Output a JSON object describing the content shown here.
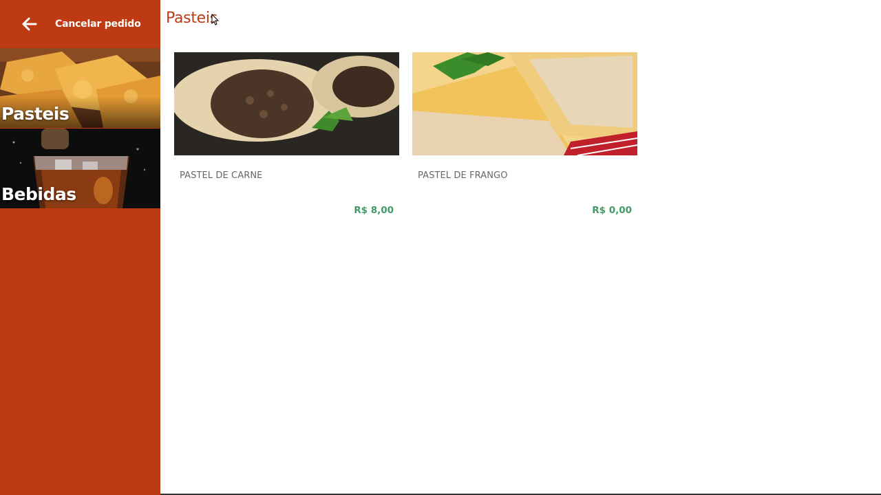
{
  "header": {
    "back_icon": "arrow-left-icon",
    "cancel_label": "Cancelar pedido"
  },
  "sidebar": {
    "categories": [
      {
        "label": "Pasteis",
        "image": "pastel-photo"
      },
      {
        "label": "Bebidas",
        "image": "soda-glass-photo"
      }
    ]
  },
  "main": {
    "title": "Pasteis",
    "products": [
      {
        "name": "PASTEL DE CARNE",
        "price": "R$ 8,00",
        "image": "beef-pastel-photo"
      },
      {
        "name": "PASTEL DE FRANGO",
        "price": "R$ 0,00",
        "image": "chicken-pastel-photo"
      }
    ]
  },
  "colors": {
    "accent": "#bd3a13",
    "price": "#3f9b66",
    "text_muted": "#666666"
  }
}
